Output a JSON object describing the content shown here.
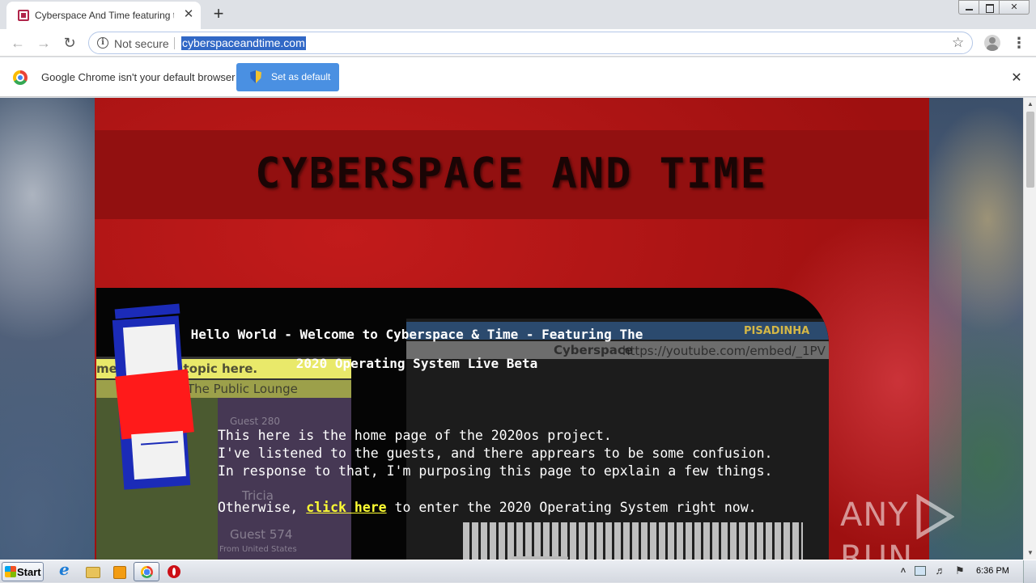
{
  "browser": {
    "tab_title": "Cyberspace And Time featuring the",
    "new_tab_symbol": "+",
    "tab_close_symbol": "✕",
    "security_label": "Not secure",
    "url": "cyberspaceandtime.com",
    "infobar_text": "Google Chrome isn't your default browser",
    "set_default_label": "Set as default",
    "infobar_close_symbol": "✕"
  },
  "page": {
    "site_title": "CYBERSPACE AND TIME",
    "hello_line1": "Hello World - Welcome to Cyberspace & Time - Featuring The",
    "hello_line2": "2020 Operating System Live Beta",
    "body_line1": "This here is the home page of the 2020os project.",
    "body_line2": "I've listened to the guests, and there apprears to be some confusion.",
    "body_line3": "In response to that, I'm purposing this page to epxlain a few things.",
    "body_line4_pre": "Otherwise, ",
    "click_here": "click here",
    "body_line4_post": " to enter the 2020 Operating System right now.",
    "ghost_chat_title": "me ... to set topic here.",
    "ghost_lounge": "The Public Lounge",
    "ghost_guest1": "Guest 280",
    "ghost_tricia": "Tricia",
    "ghost_guest2": "Guest 574",
    "ghost_from": "From United States",
    "ghost_embed_url": "https://youtube.com/embed/_1PV",
    "ghost_cyberspace": "Cyberspace",
    "ghost_pisadinha": "PISADINHA"
  },
  "watermark": {
    "left": "ANY",
    "right": "RUN"
  },
  "taskbar": {
    "start_label": "Start",
    "clock": "6:36 PM"
  },
  "colors": {
    "page_red": "#b51515",
    "link_yellow": "#ffff33",
    "logo_blue": "#1b2bb8",
    "infobar_button": "#4a90e2"
  }
}
